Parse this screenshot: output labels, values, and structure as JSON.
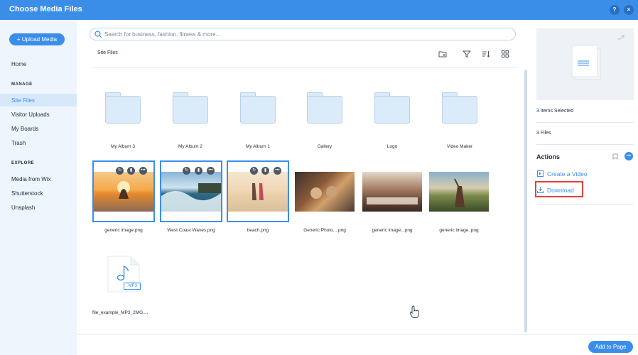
{
  "window": {
    "title": "Choose Media Files",
    "help_label": "?",
    "close_label": "×"
  },
  "sidebar": {
    "upload_label": "+ Upload Media",
    "home": "Home",
    "manage_header": "MANAGE",
    "manage_items": [
      "Site Files",
      "Visitor Uploads",
      "My Boards",
      "Trash"
    ],
    "explore_header": "EXPLORE",
    "explore_items": [
      "Media from Wix",
      "Shutterstock",
      "Unsplash"
    ],
    "active_item": "Site Files"
  },
  "search": {
    "placeholder": "Search for business, fashion, fitness & more..."
  },
  "toolbar": {
    "breadcrumb": "Site Files",
    "icons": [
      "new-folder-icon",
      "filter-icon",
      "sort-icon",
      "grid-view-icon"
    ]
  },
  "folders": [
    "My Album 3",
    "My Album 2",
    "My Album 1",
    "Gallery",
    "Logo",
    "Video Maker"
  ],
  "images": [
    {
      "name": "generic image.png",
      "selected": true
    },
    {
      "name": "West Coast Waves.png",
      "selected": true
    },
    {
      "name": "beach.png",
      "selected": true
    },
    {
      "name": "Generic Photo....png",
      "selected": false
    },
    {
      "name": "generic image...png",
      "selected": false
    },
    {
      "name": "generic image..png",
      "selected": false
    }
  ],
  "audio": {
    "name": "file_example_MP3_2MG....",
    "badge": ".MP3"
  },
  "details": {
    "selected_count": "3 Items Selected",
    "file_count": "3 Files",
    "actions_title": "Actions",
    "create_video": "Create a Video",
    "download": "Download"
  },
  "footer": {
    "add_to_page": "Add to Page"
  },
  "colors": {
    "accent": "#3b8ee8",
    "sidebar_bg": "#eef5fd",
    "highlight": "#e2413c"
  }
}
